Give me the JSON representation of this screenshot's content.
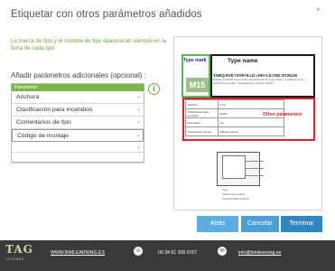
{
  "dialog": {
    "title": "Etiquetar con otros parámetros añadidos",
    "close_icon": "×",
    "info_text": "La marca de tipo y el nombre de tipo aparecerán siempre en la ficha de cada tipo",
    "add_label": "Añadir parámetros adicionales (opcional) :",
    "info_icon": "i",
    "accent_color": "#6aa83e"
  },
  "params": {
    "header": "Parameter",
    "items": [
      {
        "label": "Anchura",
        "chevron": "⌄"
      },
      {
        "label": "Clasificación para incendios",
        "chevron": "⌄"
      },
      {
        "label": "Comentarios de tipo",
        "chevron": "⌄"
      },
      {
        "label": "Código de montaje",
        "chevron": "⌄"
      },
      {
        "label": "",
        "chevron": "⌄"
      },
      {
        "label": "",
        "chevron": ""
      }
    ]
  },
  "preview": {
    "type_mark_label": "Type mark",
    "type_mark_value": "M15",
    "type_name_label": "Type name",
    "type_name_value": "TABIQ.RV8.YSVR+6.LD LHD+2,5.CER.VIT20x20",
    "type_name_desc": "Tabique de ladrillo hueco doble. Revestimiento de yeso 10mm + Ladrillo de 6 mm + Ladrillo hueco doble + Revestimiento cerámico 20x20",
    "other_params_label": "Other parameters",
    "rows": [
      {
        "name": "Anchura",
        "value": "0.11"
      },
      {
        "name": "Clasificación para incendios",
        "value": "EI120"
      },
      {
        "name": "Nota clave",
        "value": "No"
      },
      {
        "name": "Comentarios de tipo",
        "value": "Tabique interior"
      }
    ],
    "sketch_labels": [
      "Yeso",
      "Ladrillo hueco doble",
      "Cerámica blanca 20x20"
    ],
    "colors": {
      "type_mark_border": "#5cb85c",
      "type_name_border": "#1a1a1a",
      "other_params": "#e01e2c"
    }
  },
  "buttons": {
    "back": "Atrás",
    "cancel": "Cancelar",
    "finish": "Terminar"
  },
  "footer": {
    "logo": "TAG",
    "logo_sub": "LEGENDS",
    "url": "WWW.BIMLEARNING.ES",
    "phone_icon": "☏",
    "phone": "00 34 91 200 0757",
    "mail_icon": "✉",
    "email": "info@bimlearning.es"
  }
}
